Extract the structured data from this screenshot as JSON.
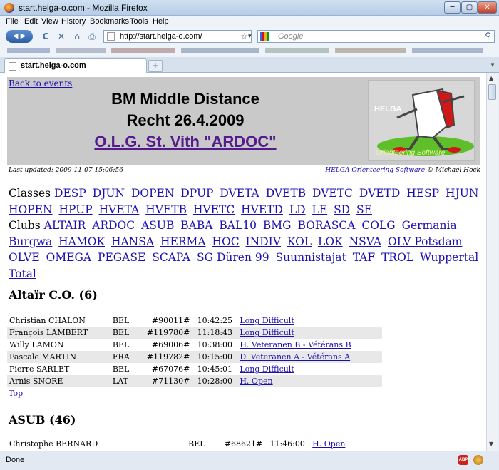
{
  "window": {
    "title": "start.helga-o.com - Mozilla Firefox",
    "min": "─",
    "max": "▢",
    "close": "✕"
  },
  "menu": [
    "File",
    "Edit",
    "View",
    "History",
    "Bookmarks",
    "Tools",
    "Help"
  ],
  "nav": {
    "url": "http://start.helga-o.com/",
    "search_placeholder": "Google",
    "back_forward": "◀ ▶",
    "reload": "C",
    "stop": "✕",
    "home": "⌂",
    "print": "⎙",
    "star": "☆",
    "dropdown": "▾",
    "search_icon": "⚲"
  },
  "tab": {
    "label": "start.helga-o.com",
    "new_tab": "+",
    "list": "▾"
  },
  "page": {
    "back_link": "Back to events",
    "title1": "BM Middle Distance",
    "title2": "Recht 26.4.2009",
    "club": "O.L.G. St. Vith \"ARDOC\"",
    "logo_text": "HELGA",
    "logo_sub": "Orienteering Software",
    "last_updated": "Last updated: 2009-11-07 15:06:56",
    "credit_link": "HELGA Orienteering Software",
    "credit_rest": " © Michael Hock",
    "classes_label": "Classes",
    "classes": [
      "DESP",
      "DJUN",
      "DOPEN",
      "DPUP",
      "DVETA",
      "DVETB",
      "DVETC",
      "DVETD",
      "HESP",
      "HJUN",
      "HOPEN",
      "HPUP",
      "HVETA",
      "HVETB",
      "HVETC",
      "HVETD",
      "LD",
      "LE",
      "SD",
      "SE"
    ],
    "clubs_label": "Clubs",
    "clubs": [
      "ALTAIR",
      "ARDOC",
      "ASUB",
      "BABA",
      "BAL10",
      "BMG",
      "BORASCA",
      "COLG",
      "Germania",
      "Burgwa",
      "HAMOK",
      "HANSA",
      "HERMA",
      "HOC",
      "INDIV",
      "KOL",
      "LOK",
      "NSVA",
      "OLV Potsdam",
      "OLVE",
      "OMEGA",
      "PEGASE",
      "SCAPA",
      "SG Düren 99",
      "Suunnistajat",
      "TAF",
      "TROL",
      "Wuppertal",
      "Total"
    ],
    "sections": [
      {
        "heading": "Altaïr C.O. (6)",
        "rows": [
          [
            "Christian CHALON",
            "BEL",
            "#90011#",
            "10:42:25",
            "Long Difficult"
          ],
          [
            "François LAMBERT",
            "BEL",
            "#119780#",
            "11:18:43",
            "Long Difficult"
          ],
          [
            "Willy LAMON",
            "BEL",
            "#69006#",
            "10:38:00",
            "H. Veteranen B - Vétérans B"
          ],
          [
            "Pascale MARTIN",
            "FRA",
            "#119782#",
            "10:15:00",
            "D. Veteranen A - Vétérans A"
          ],
          [
            "Pierre SARLET",
            "BEL",
            "#67076#",
            "10:45:01",
            "Long Difficult"
          ],
          [
            "Arnis SNORE",
            "LAT",
            "#71130#",
            "10:28:00",
            "H. Open"
          ]
        ],
        "top_link": "Top"
      },
      {
        "heading": "ASUB (46)",
        "rows": [
          [
            "Christophe BERNARD",
            "BEL",
            "#68621#",
            "11:46:00",
            "H. Open"
          ]
        ]
      }
    ]
  },
  "status": {
    "text": "Done",
    "abp": "ABP"
  }
}
